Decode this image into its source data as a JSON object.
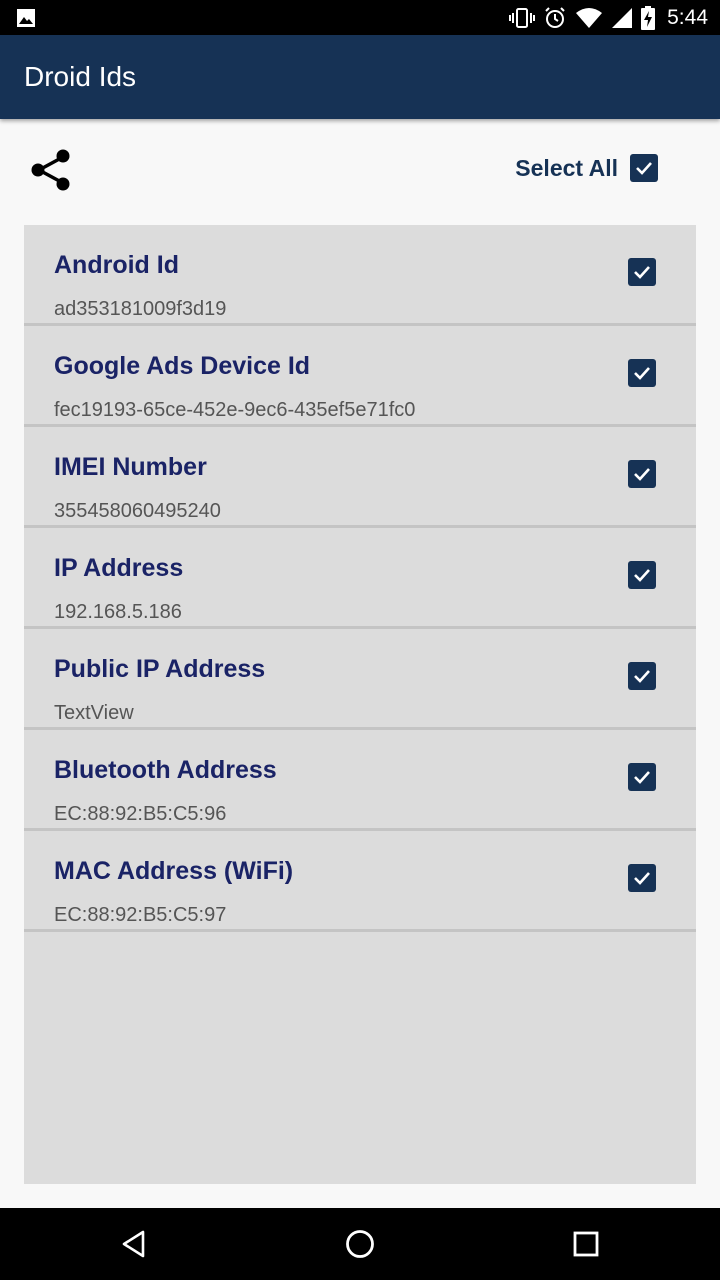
{
  "status_bar": {
    "time": "5:44",
    "icons": [
      "image-notification-icon",
      "vibrate-icon",
      "alarm-icon",
      "wifi-icon",
      "signal-icon",
      "battery-charging-icon"
    ]
  },
  "app_bar": {
    "title": "Droid Ids"
  },
  "toolbar": {
    "share_icon": "share-icon",
    "select_all_label": "Select All",
    "select_all_checked": true
  },
  "items": [
    {
      "title": "Android Id",
      "value": "ad353181009f3d19",
      "checked": true
    },
    {
      "title": "Google Ads Device Id",
      "value": "fec19193-65ce-452e-9ec6-435ef5e71fc0",
      "checked": true
    },
    {
      "title": "IMEI Number",
      "value": "355458060495240",
      "checked": true
    },
    {
      "title": "IP Address",
      "value": "192.168.5.186",
      "checked": true
    },
    {
      "title": "Public IP Address",
      "value": "TextView",
      "checked": true
    },
    {
      "title": "Bluetooth Address",
      "value": "EC:88:92:B5:C5:96",
      "checked": true
    },
    {
      "title": "MAC Address (WiFi)",
      "value": "EC:88:92:B5:C5:97",
      "checked": true
    }
  ],
  "nav_bar": {
    "icons": [
      "back-icon",
      "home-icon",
      "recents-icon"
    ]
  },
  "colors": {
    "app_bar": "#163255",
    "accent": "#163255",
    "title_text": "#1a2366",
    "panel": "#dcdcdc"
  }
}
